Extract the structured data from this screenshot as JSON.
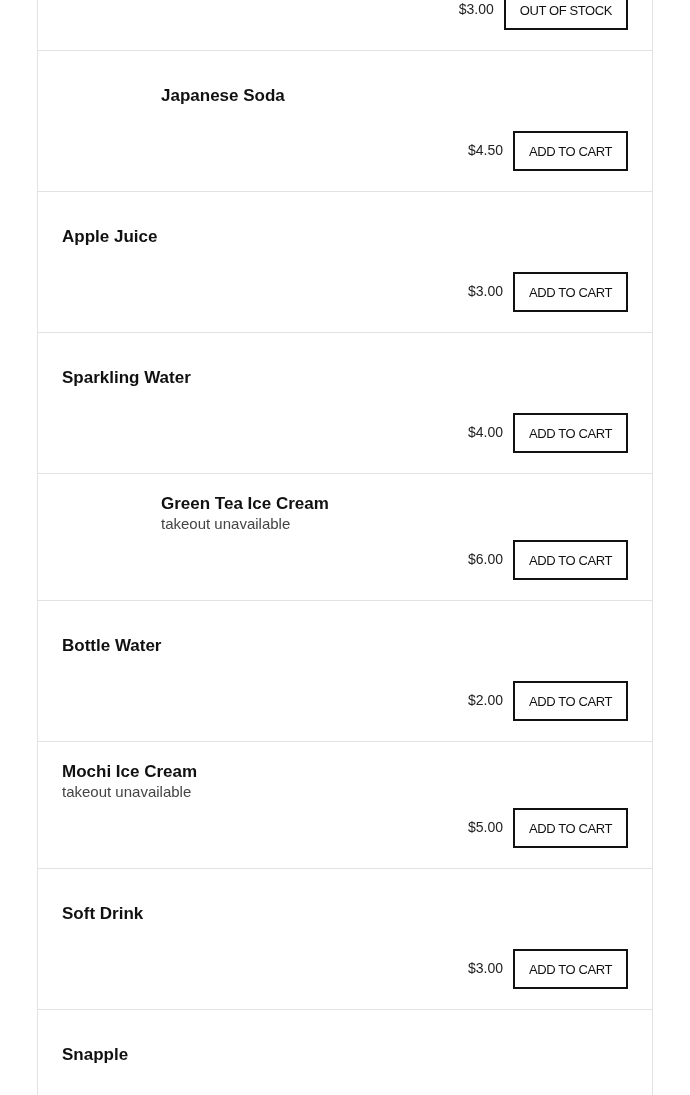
{
  "items": [
    {
      "price": "$3.00",
      "button": "OUT OF STOCK"
    },
    {
      "name": "Japanese Soda",
      "has_photo": true,
      "price": "$4.50",
      "button": "ADD TO CART"
    },
    {
      "name": "Apple Juice",
      "has_photo": false,
      "price": "$3.00",
      "button": "ADD TO CART"
    },
    {
      "name": "Sparkling Water",
      "has_photo": false,
      "price": "$4.00",
      "button": "ADD TO CART"
    },
    {
      "name": "Green Tea Ice Cream",
      "note": "takeout unavailable",
      "has_photo": true,
      "price": "$6.00",
      "button": "ADD TO CART"
    },
    {
      "name": "Bottle Water",
      "has_photo": false,
      "price": "$2.00",
      "button": "ADD TO CART"
    },
    {
      "name": "Mochi Ice Cream",
      "note": "takeout unavailable",
      "has_photo": false,
      "price": "$5.00",
      "button": "ADD TO CART"
    },
    {
      "name": "Soft Drink",
      "has_photo": false,
      "price": "$3.00",
      "button": "ADD TO CART"
    },
    {
      "name": "Snapple",
      "has_photo": false
    }
  ]
}
